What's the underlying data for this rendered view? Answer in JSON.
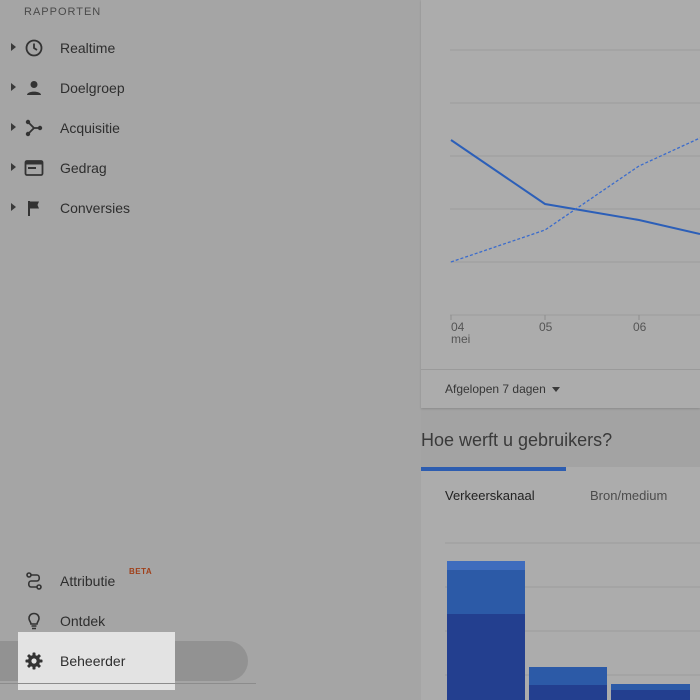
{
  "sidebar": {
    "section_header": "RAPPORTEN",
    "items": [
      {
        "label": "Realtime",
        "icon": "clock-icon"
      },
      {
        "label": "Doelgroep",
        "icon": "person-icon"
      },
      {
        "label": "Acquisitie",
        "icon": "fork-icon"
      },
      {
        "label": "Gedrag",
        "icon": "browser-window-icon"
      },
      {
        "label": "Conversies",
        "icon": "flag-icon"
      }
    ],
    "bottom_items": [
      {
        "label": "Attributie",
        "icon": "attribution-path-icon",
        "badge": "BETA"
      },
      {
        "label": "Ontdek",
        "icon": "lightbulb-icon"
      },
      {
        "label": "Beheerder",
        "icon": "gear-icon",
        "selected": true
      }
    ]
  },
  "main": {
    "top_card": {
      "x_ticks": [
        {
          "day": "04",
          "month": "mei"
        },
        {
          "day": "05",
          "month": ""
        },
        {
          "day": "06",
          "month": ""
        }
      ],
      "date_range_label": "Afgelopen 7 dagen"
    },
    "acquisition": {
      "title": "Hoe werft u gebruikers?",
      "tabs": [
        {
          "label": "Verkeerskanaal",
          "active": true
        },
        {
          "label": "Bron/medium",
          "active": false
        }
      ]
    }
  },
  "colors": {
    "accent": "#2d5db0",
    "line_solid": "#2c5fb8",
    "line_dashed": "#3b6ccc",
    "bar_dark": "#233f8f",
    "bar_mid": "#2c5aa7",
    "bar_light": "#3f6cbd"
  }
}
